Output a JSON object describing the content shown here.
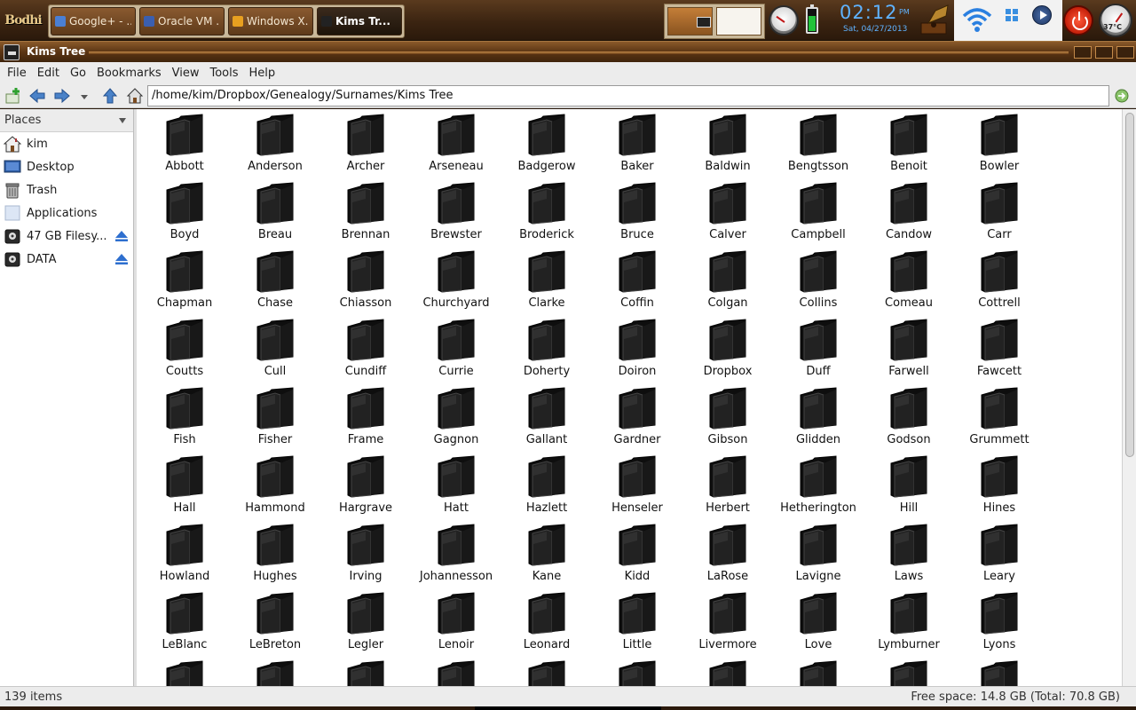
{
  "panel": {
    "logo_text": "Bodhi",
    "tasks": [
      {
        "label": "Google+ - ...",
        "icon_color": "#4a7fd4",
        "active": false
      },
      {
        "label": "Oracle VM ...",
        "icon_color": "#3b5fb0",
        "active": false
      },
      {
        "label": "Windows X...",
        "icon_color": "#e8a020",
        "active": false
      },
      {
        "label": "Kims Tr...",
        "icon_color": "#222222",
        "active": true
      }
    ],
    "clock": {
      "time": "02:12",
      "ampm": "PM",
      "date": "Sat, 04/27/2013"
    },
    "temperature": "37°C",
    "battery_level": 0.65
  },
  "window": {
    "title": "Kims Tree"
  },
  "menu": [
    "File",
    "Edit",
    "Go",
    "Bookmarks",
    "View",
    "Tools",
    "Help"
  ],
  "toolbar": {
    "location": "/home/kim/Dropbox/Genealogy/Surnames/Kims Tree"
  },
  "sidebar": {
    "header": "Places",
    "items": [
      {
        "label": "kim",
        "icon": "home-icon",
        "eject": false
      },
      {
        "label": "Desktop",
        "icon": "desktop-icon",
        "eject": false
      },
      {
        "label": "Trash",
        "icon": "trash-icon",
        "eject": false
      },
      {
        "label": "Applications",
        "icon": "applications-icon",
        "eject": false
      },
      {
        "label": "47 GB Filesy...",
        "icon": "drive-icon",
        "eject": true
      },
      {
        "label": "DATA",
        "icon": "drive-icon",
        "eject": true
      }
    ]
  },
  "files": [
    "Abbott",
    "Anderson",
    "Archer",
    "Arseneau",
    "Badgerow",
    "Baker",
    "Baldwin",
    "Bengtsson",
    "Benoit",
    "Bowler",
    "Boyd",
    "Breau",
    "Brennan",
    "Brewster",
    "Broderick",
    "Bruce",
    "Calver",
    "Campbell",
    "Candow",
    "Carr",
    "Chapman",
    "Chase",
    "Chiasson",
    "Churchyard",
    "Clarke",
    "Coffin",
    "Colgan",
    "Collins",
    "Comeau",
    "Cottrell",
    "Coutts",
    "Cull",
    "Cundiff",
    "Currie",
    "Doherty",
    "Doiron",
    "Dropbox",
    "Duff",
    "Farwell",
    "Fawcett",
    "Fish",
    "Fisher",
    "Frame",
    "Gagnon",
    "Gallant",
    "Gardner",
    "Gibson",
    "Glidden",
    "Godson",
    "Grummett",
    "Hall",
    "Hammond",
    "Hargrave",
    "Hatt",
    "Hazlett",
    "Henseler",
    "Herbert",
    "Hetherington",
    "Hill",
    "Hines",
    "Howland",
    "Hughes",
    "Irving",
    "Johannesson",
    "Kane",
    "Kidd",
    "LaRose",
    "Lavigne",
    "Laws",
    "Leary",
    "LeBlanc",
    "LeBreton",
    "Legler",
    "Lenoir",
    "Leonard",
    "Little",
    "Livermore",
    "Love",
    "Lymburner",
    "Lyons",
    "",
    "",
    "",
    "",
    "",
    "",
    "",
    "",
    "",
    ""
  ],
  "status": {
    "count": "139 items",
    "free_space": "Free space: 14.8 GB (Total: 70.8 GB)"
  }
}
